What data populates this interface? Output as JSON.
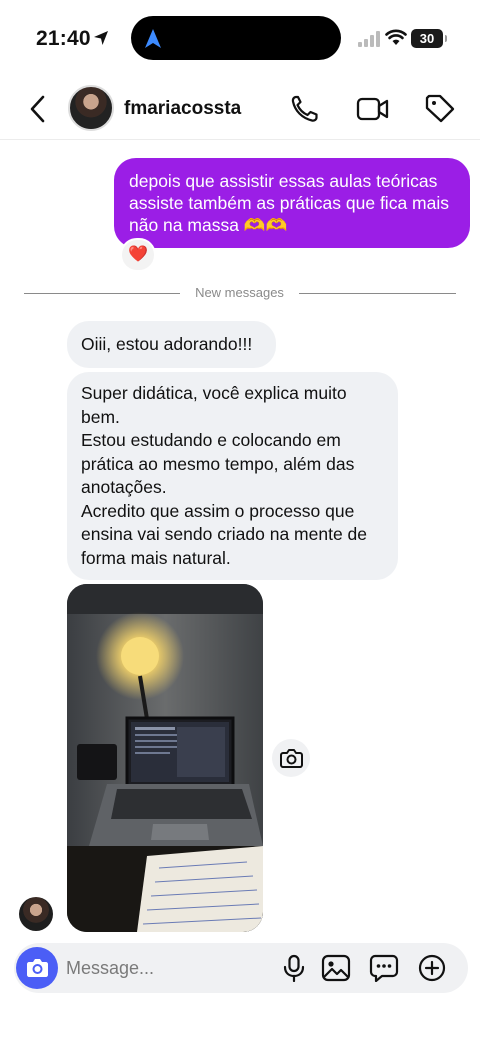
{
  "status_bar": {
    "time": "21:40",
    "battery": "30"
  },
  "header": {
    "username": "fmariacossta",
    "icons": [
      "back-icon",
      "phone-icon",
      "video-icon",
      "tag-icon"
    ]
  },
  "messages": {
    "sent": {
      "text": "depois que assistir essas aulas teóricas assiste também as práticas que fica mais não na massa 🫶🫶",
      "reaction": "❤️"
    },
    "divider": "New messages",
    "received": [
      {
        "text": "Oiii, estou adorando!!!"
      },
      {
        "paragraphs": [
          "Super didática, você explica muito bem.",
          "Estou estudando e colocando em prática ao mesmo tempo, além das anotações.",
          "Acredito que assim o processo que ensina vai sendo criado na mente de forma mais natural."
        ]
      }
    ],
    "photo_description_icon": "camera-icon"
  },
  "composer": {
    "placeholder": "Message...",
    "icons": [
      "camera-icon",
      "mic-icon",
      "gallery-icon",
      "sticker-icon",
      "plus-icon"
    ]
  },
  "colors": {
    "sent_bubble": "#9b1ee6",
    "received_bubble": "#eff1f4",
    "camera_button": "#4b5ef6"
  }
}
